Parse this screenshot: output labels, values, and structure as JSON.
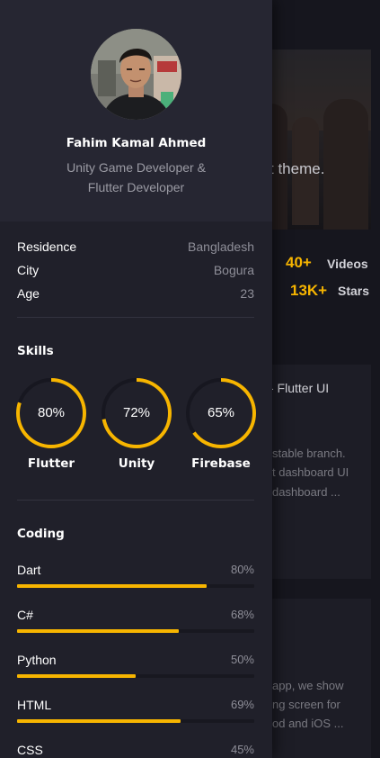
{
  "accent_color": "#f7b500",
  "background": {
    "hero_text": "t theme.",
    "stats": [
      {
        "value": "40+",
        "label": "Videos"
      },
      {
        "value": "13K+",
        "label": "Stars"
      }
    ],
    "card1": {
      "title": "- Flutter UI",
      "lines": [
        "stable branch.",
        "t dashboard UI",
        "dashboard ..."
      ]
    },
    "card2": {
      "lines": [
        "app, we show",
        "ng screen for",
        "od and iOS ..."
      ]
    }
  },
  "profile": {
    "name": "Fahim Kamal Ahmed",
    "role_line1": "Unity Game Developer &",
    "role_line2": "Flutter Developer"
  },
  "info": [
    {
      "key": "Residence",
      "value": "Bangladesh"
    },
    {
      "key": "City",
      "value": "Bogura"
    },
    {
      "key": "Age",
      "value": "23"
    }
  ],
  "skills": {
    "title": "Skills",
    "items": [
      {
        "label": "Flutter",
        "percent_text": "80%",
        "percent": 0.8
      },
      {
        "label": "Unity",
        "percent_text": "72%",
        "percent": 0.72
      },
      {
        "label": "Firebase",
        "percent_text": "65%",
        "percent": 0.65
      }
    ]
  },
  "coding": {
    "title": "Coding",
    "items": [
      {
        "label": "Dart",
        "percent_text": "80%",
        "percent": 0.8
      },
      {
        "label": "C#",
        "percent_text": "68%",
        "percent": 0.68
      },
      {
        "label": "Python",
        "percent_text": "50%",
        "percent": 0.5
      },
      {
        "label": "HTML",
        "percent_text": "69%",
        "percent": 0.69
      },
      {
        "label": "CSS",
        "percent_text": "45%",
        "percent": 0.45
      }
    ]
  }
}
